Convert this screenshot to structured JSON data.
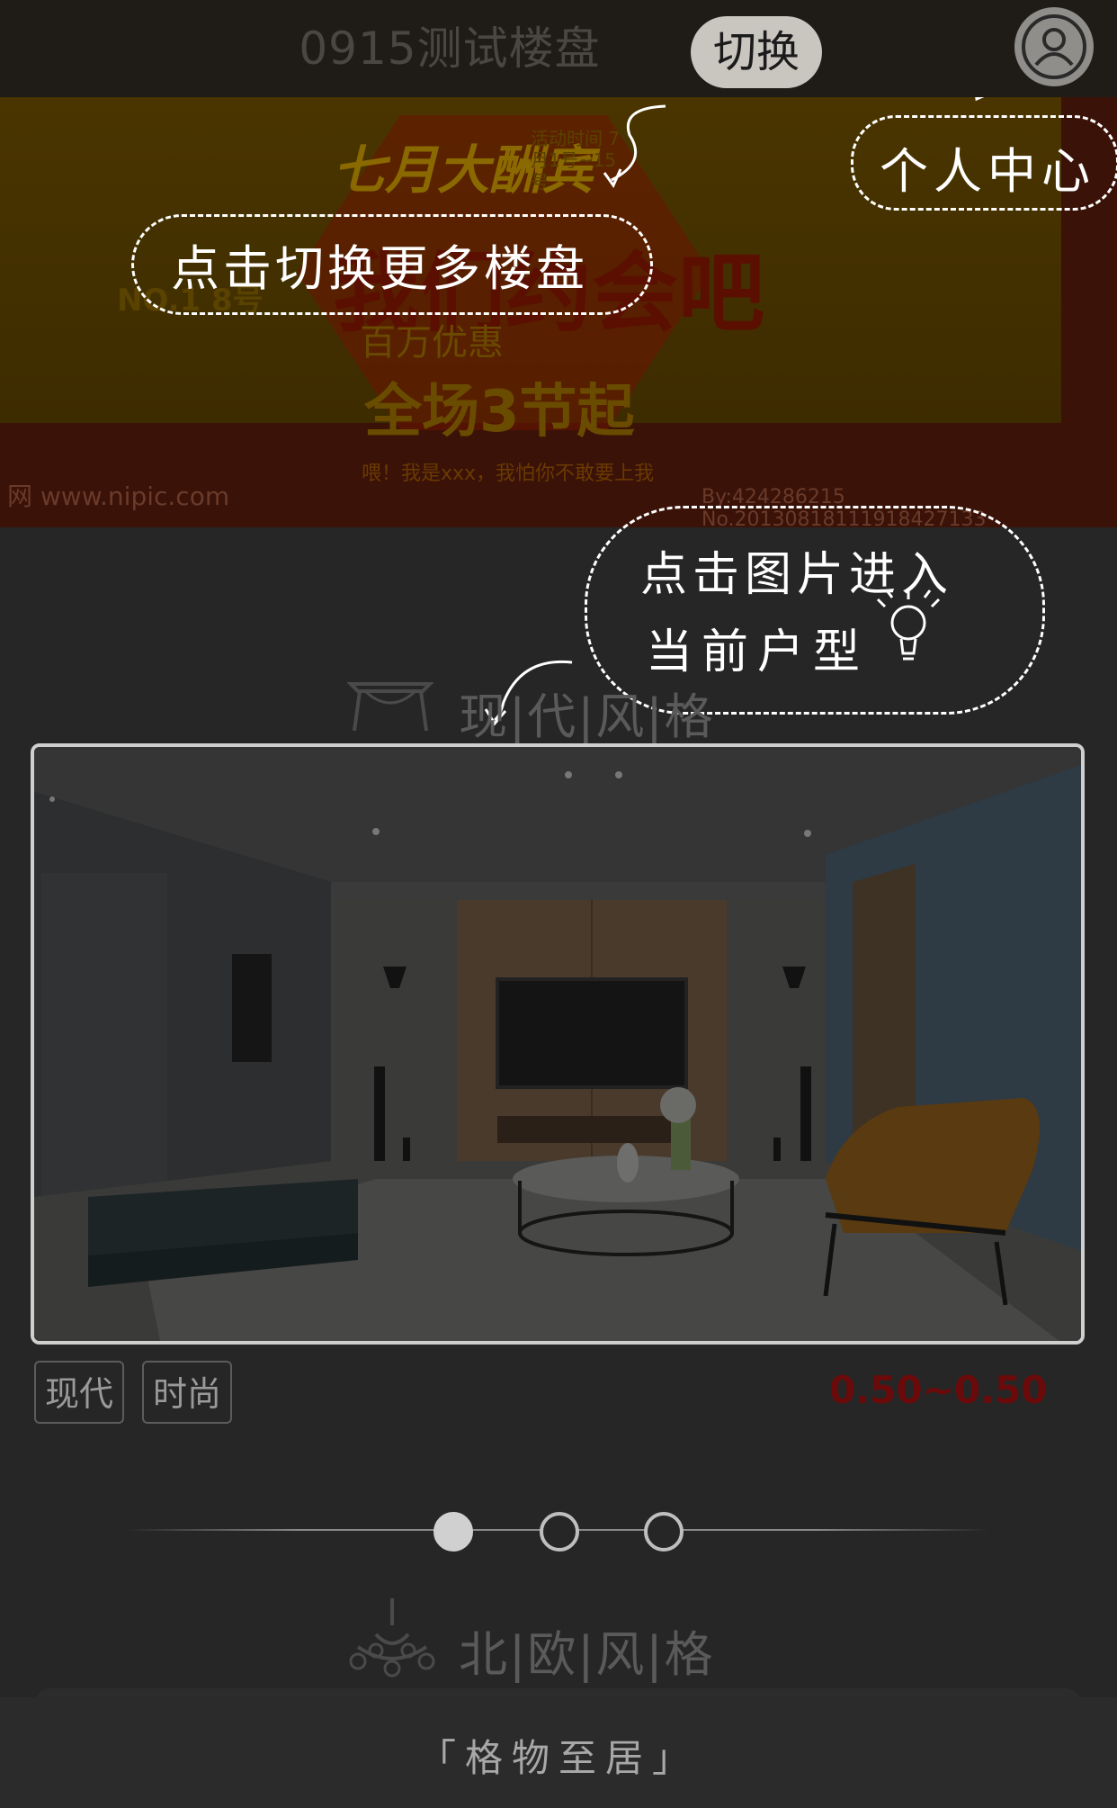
{
  "header": {
    "title": "0915测试楼盘",
    "switch_label": "切换",
    "profile_icon": "user-icon"
  },
  "banner": {
    "headline": "七月大酬宾",
    "date": "活动时间 7月1号~15号",
    "main_text": "我们约会吧",
    "mid_text": "百万优惠",
    "line_text": "全场3节起",
    "bottom_text": "喂！我是xxx，我怕你不敢要上我",
    "badge": "NO.1 8号",
    "site": "网 www.nipic.com",
    "id": "By:424286215 No.20130818111918427133"
  },
  "guide_notes": {
    "switch_note": "点击切换更多楼盘",
    "profile_note": "个人中心",
    "enter_note_line1": "点击图片进入",
    "enter_note_line2": "当前户型"
  },
  "sections": [
    {
      "title": "现|代|风|格",
      "icon": "table-icon",
      "tags": [
        "现代",
        "时尚"
      ],
      "price": "0.50~0.50"
    },
    {
      "title": "北|欧|风|格",
      "icon": "chandelier-icon"
    }
  ],
  "pager": {
    "count": 3,
    "active": 1
  },
  "footer": {
    "text": "「格物至居」"
  },
  "colors": {
    "background": "#262626",
    "price": "#6b0a0a",
    "note_stroke": "#ffffff"
  }
}
